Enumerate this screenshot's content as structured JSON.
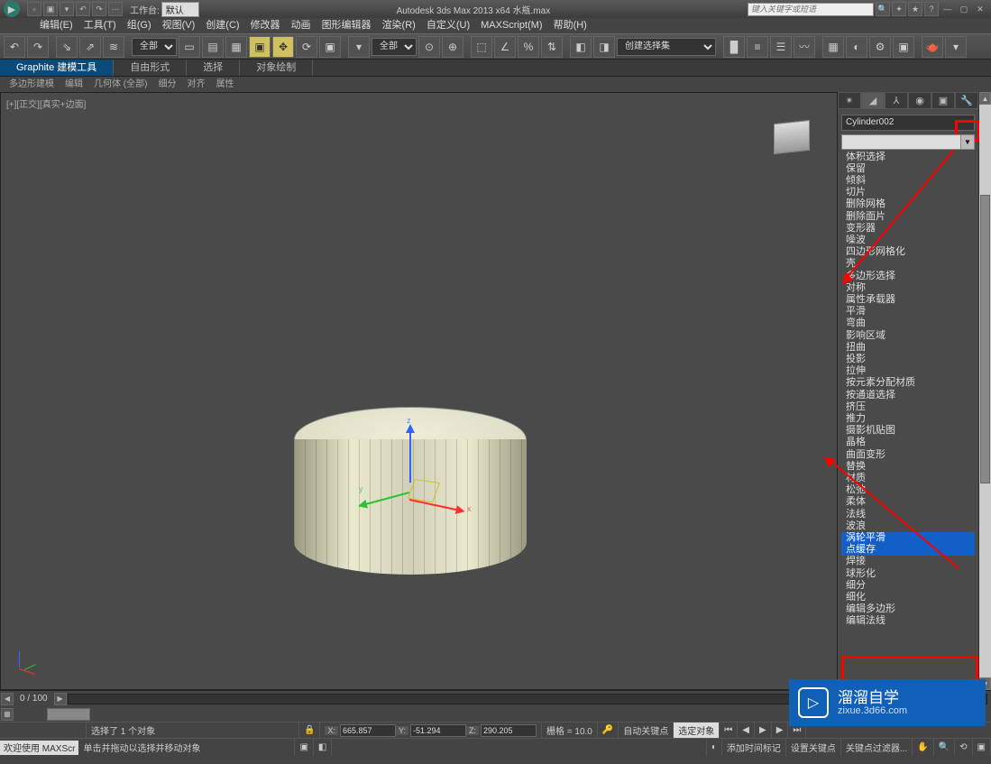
{
  "title_bar": {
    "workspace_label": "工作台:",
    "workspace_value": "默认",
    "app_title": "Autodesk 3ds Max  2013 x64   水瓶.max",
    "search_placeholder": "键入关键字或短语"
  },
  "menu": [
    "编辑(E)",
    "工具(T)",
    "组(G)",
    "视图(V)",
    "创建(C)",
    "修改器",
    "动画",
    "图形编辑器",
    "渲染(R)",
    "自定义(U)",
    "MAXScript(M)",
    "帮助(H)"
  ],
  "toolbar": {
    "selset_all": "全部",
    "selset_name": "创建选择集"
  },
  "ribbon_tabs": [
    "Graphite 建模工具",
    "自由形式",
    "选择",
    "对象绘制"
  ],
  "sub_ribbon": [
    "多边形建模",
    "编辑",
    "几何体 (全部)",
    "细分",
    "对齐",
    "属性"
  ],
  "viewport": {
    "label": "[+][正交][真实+边面]",
    "axis": {
      "x": "x",
      "y": "y",
      "z": "z"
    }
  },
  "cmd_panel": {
    "object_name": "Cylinder002",
    "modifiers": [
      "体积选择",
      "保留",
      "倾斜",
      "切片",
      "删除网格",
      "删除面片",
      "变形器",
      "噪波",
      "四边形网格化",
      "壳",
      "多边形选择",
      "对称",
      "属性承载器",
      "平滑",
      "弯曲",
      "影响区域",
      "扭曲",
      "投影",
      "拉伸",
      "按元素分配材质",
      "按通道选择",
      "挤压",
      "推力",
      "摄影机贴图",
      "晶格",
      "曲面变形",
      "替换",
      "材质",
      "松弛",
      "柔体",
      "法线",
      "波浪",
      "涡轮平滑",
      "点缓存",
      "焊接",
      "球形化",
      "细分",
      "细化",
      "编辑多边形",
      "编辑法线"
    ],
    "highlight_idx": 32,
    "highlight2_idx": 33
  },
  "timeline": {
    "frame_label": "0 / 100"
  },
  "status": {
    "selected": "选择了 1 个对象",
    "hint": "单击并拖动以选择并移动对象",
    "x": "665.857",
    "y": "-51.294",
    "z": "290.205",
    "grid": "栅格 = 10.0",
    "add_time_tag": "添加时间标记",
    "autokey": "自动关键点",
    "selobj": "选定对象",
    "setkey": "设置关键点",
    "keyfilter": "关键点过滤器...",
    "welcome": "欢迎使用  MAXScr"
  },
  "watermark": {
    "title": "溜溜自学",
    "sub": "zixue.3d66.com"
  }
}
